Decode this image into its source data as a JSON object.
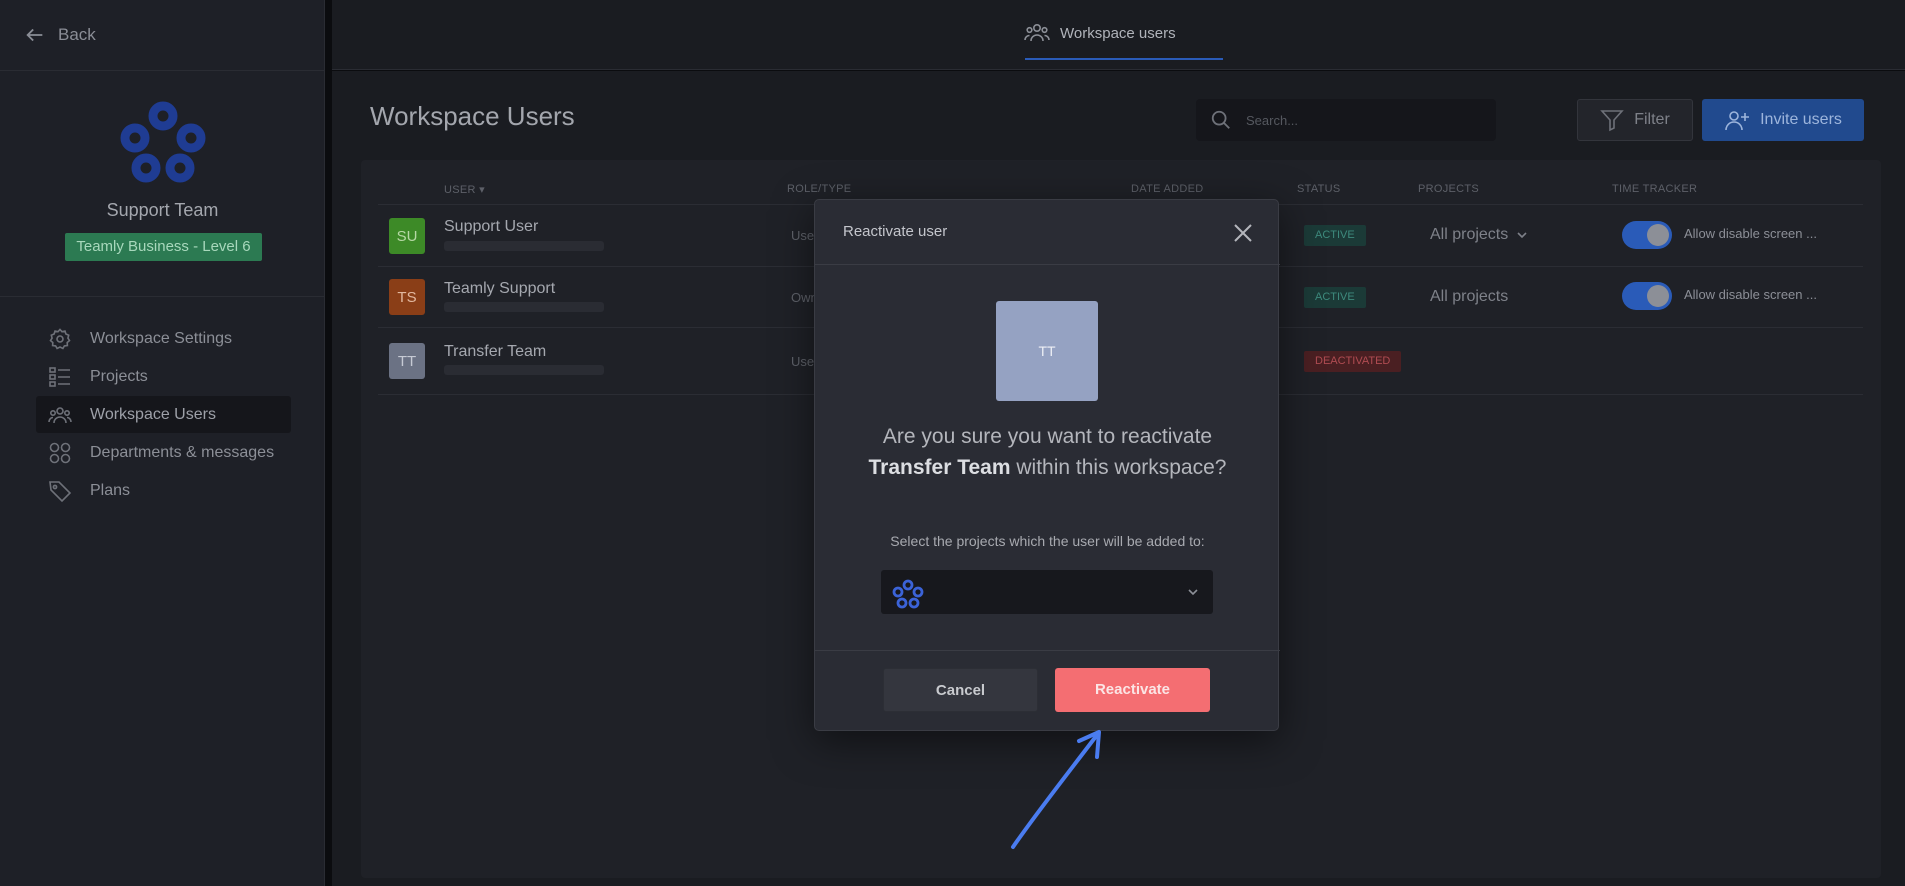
{
  "sidebar": {
    "back_label": "Back",
    "team_name": "Support Team",
    "plan_badge": "Teamly Business - Level 6",
    "items": [
      {
        "label": "Workspace Settings",
        "icon": "gear-icon"
      },
      {
        "label": "Projects",
        "icon": "projects-list-icon"
      },
      {
        "label": "Workspace Users",
        "icon": "users-icon",
        "active": true
      },
      {
        "label": "Departments & messages",
        "icon": "departments-grid-icon"
      },
      {
        "label": "Plans",
        "icon": "tag-icon"
      }
    ]
  },
  "topbar": {
    "tab_label": "Workspace users"
  },
  "main": {
    "title": "Workspace Users",
    "search_placeholder": "Search...",
    "filter_label": "Filter",
    "invite_label": "Invite users",
    "columns": [
      "USER",
      "ROLE/TYPE",
      "DATE ADDED",
      "STATUS",
      "PROJECTS",
      "TIME TRACKER"
    ],
    "users": [
      {
        "initials": "SU",
        "name": "Support User",
        "role": "Use",
        "status": "ACTIVE",
        "projects": "All projects",
        "tracker": "Allow disable screen ...",
        "avatar_color": "#3d8a27"
      },
      {
        "initials": "TS",
        "name": "Teamly Support",
        "role": "Own",
        "status": "ACTIVE",
        "projects": "All projects",
        "tracker": "Allow disable screen ...",
        "avatar_color": "#8a3e17"
      },
      {
        "initials": "TT",
        "name": "Transfer Team",
        "role": "Use",
        "status": "DEACTIVATED",
        "projects": "",
        "tracker": "",
        "avatar_color": "#6b7284"
      }
    ]
  },
  "modal": {
    "title": "Reactivate user",
    "avatar_initials": "TT",
    "question_pre": "Are you sure you want to reactivate",
    "question_name": "Transfer Team",
    "question_post": "within this workspace?",
    "subtext": "Select the projects which the user will be added to:",
    "cancel_label": "Cancel",
    "reactivate_label": "Reactivate"
  },
  "colors": {
    "accent_blue": "#2a5bb8",
    "reactivate": "#f46e72",
    "annotation_arrow": "#4a7cf0"
  }
}
